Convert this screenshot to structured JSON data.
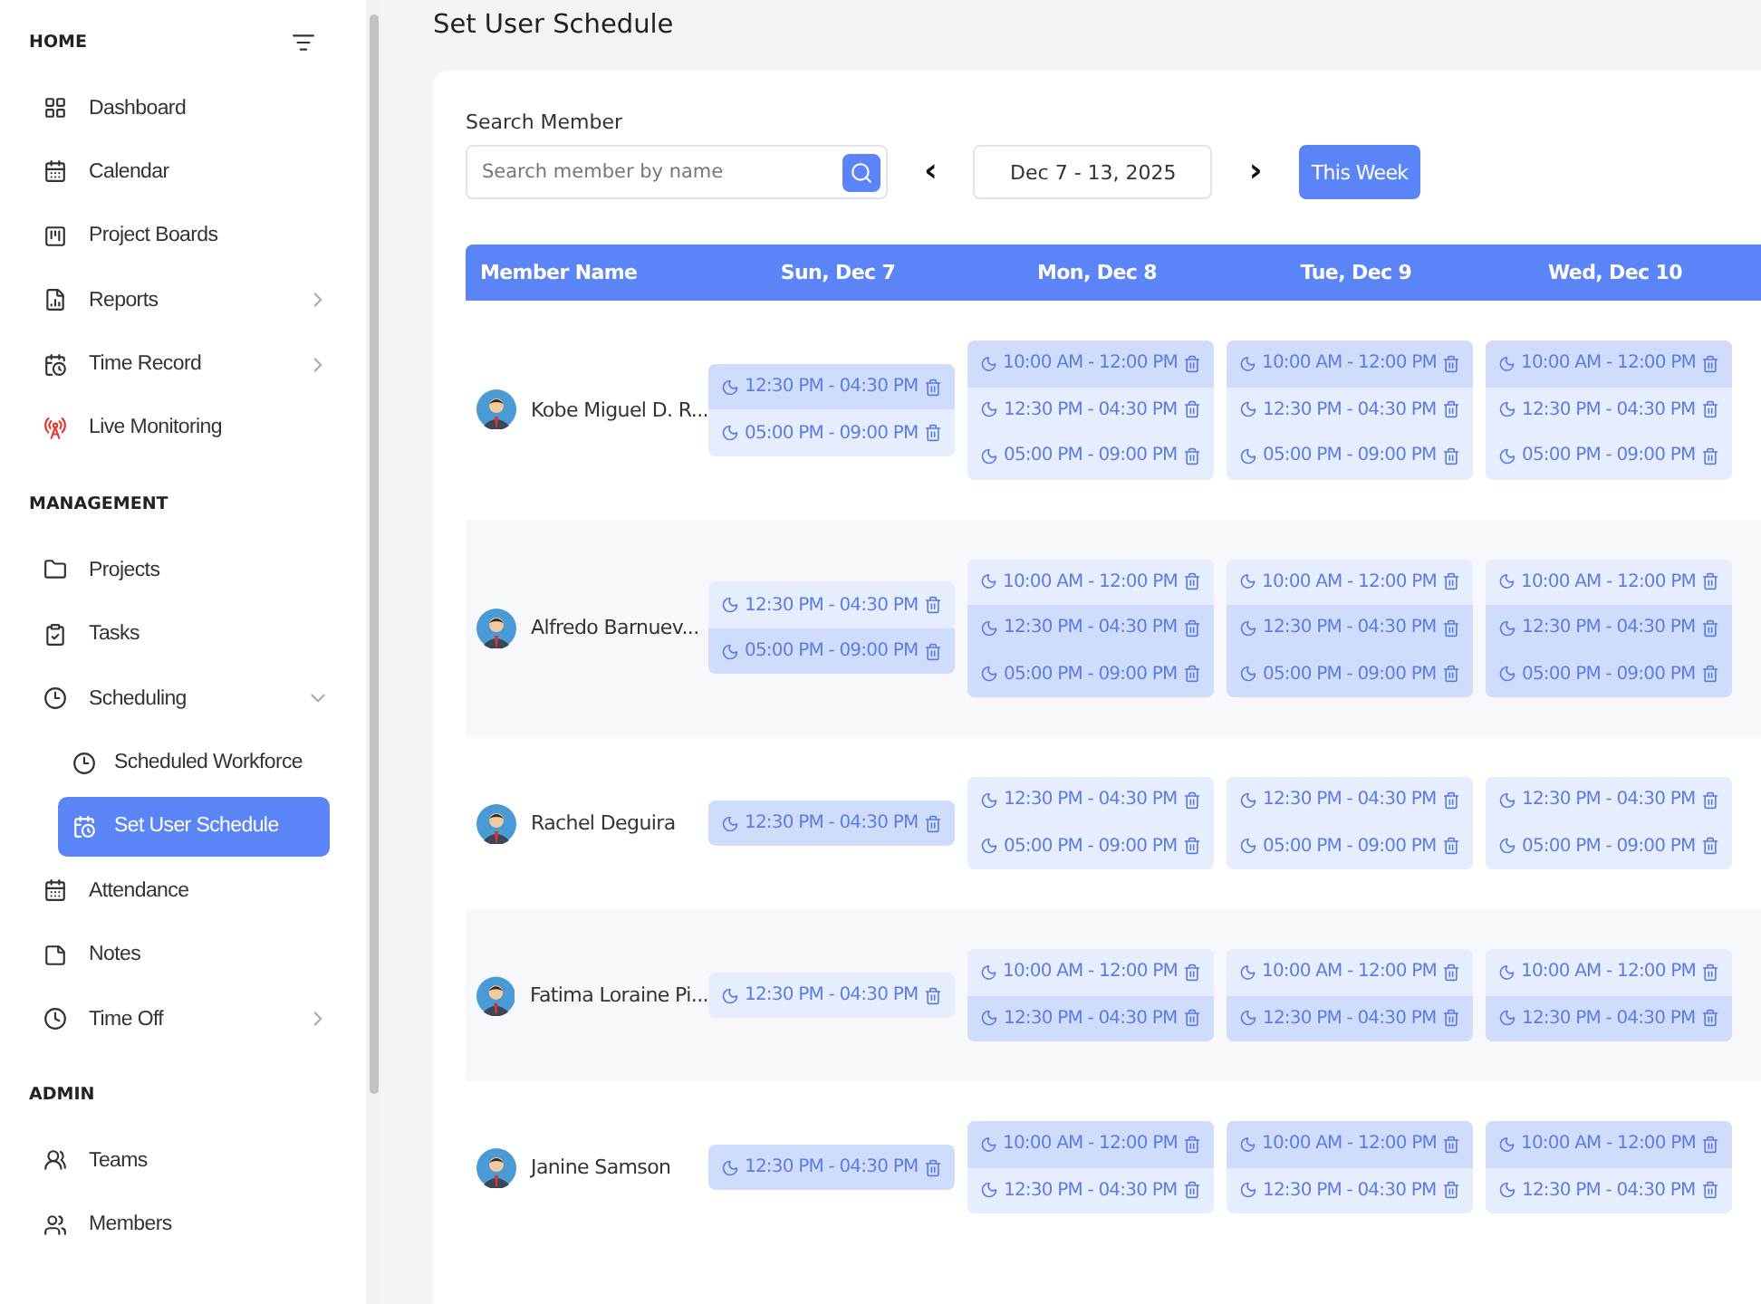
{
  "sidebar": {
    "sections": [
      {
        "heading": "HOME",
        "items": [
          {
            "label": "Dashboard",
            "kind": "link",
            "selected": false
          },
          {
            "label": "Calendar",
            "kind": "link",
            "selected": false
          },
          {
            "label": "Project Boards",
            "kind": "link",
            "selected": false
          },
          {
            "label": "Reports",
            "kind": "group",
            "expanded": false,
            "selected": false
          },
          {
            "label": "Time Record",
            "kind": "group",
            "expanded": false,
            "selected": false
          },
          {
            "label": "Live Monitoring",
            "kind": "link",
            "selected": false
          }
        ]
      },
      {
        "heading": "MANAGEMENT",
        "items": [
          {
            "label": "Projects",
            "kind": "link",
            "selected": false
          },
          {
            "label": "Tasks",
            "kind": "link",
            "selected": false
          },
          {
            "label": "Scheduling",
            "kind": "group",
            "expanded": true,
            "selected": false,
            "children": [
              {
                "label": "Scheduled Workforce",
                "selected": false
              },
              {
                "label": "Set User Schedule",
                "selected": true
              }
            ]
          },
          {
            "label": "Attendance",
            "kind": "link",
            "selected": false
          },
          {
            "label": "Notes",
            "kind": "link",
            "selected": false
          },
          {
            "label": "Time Off",
            "kind": "group",
            "expanded": false,
            "selected": false
          }
        ]
      },
      {
        "heading": "ADMIN",
        "items": [
          {
            "label": "Teams",
            "kind": "link",
            "selected": false
          },
          {
            "label": "Members",
            "kind": "link",
            "selected": false
          }
        ]
      }
    ]
  },
  "page_title": "Set User Schedule",
  "search": {
    "label": "Search Member",
    "placeholder": "Search member by name"
  },
  "week": {
    "prev": "‹",
    "range": "Dec 7 - 13, 2025",
    "next": "›",
    "this_week": "This Week"
  },
  "table": {
    "columns": [
      "Member Name",
      "Sun, Dec 7",
      "Mon, Dec 8",
      "Tue, Dec 9",
      "Wed, Dec 10"
    ],
    "rows": [
      {
        "name": "Kobe Miguel D. R...",
        "days": [
          [
            {
              "time": "12:30 PM - 04:30 PM",
              "highlighted": true
            },
            {
              "time": "05:00 PM - 09:00 PM",
              "highlighted": false
            }
          ],
          [
            {
              "time": "10:00 AM - 12:00 PM",
              "highlighted": true
            },
            {
              "time": "12:30 PM - 04:30 PM",
              "highlighted": false
            },
            {
              "time": "05:00 PM - 09:00 PM",
              "highlighted": false
            }
          ],
          [
            {
              "time": "10:00 AM - 12:00 PM",
              "highlighted": true
            },
            {
              "time": "12:30 PM - 04:30 PM",
              "highlighted": false
            },
            {
              "time": "05:00 PM - 09:00 PM",
              "highlighted": false
            }
          ],
          [
            {
              "time": "10:00 AM - 12:00 PM",
              "highlighted": true
            },
            {
              "time": "12:30 PM - 04:30 PM",
              "highlighted": false
            },
            {
              "time": "05:00 PM - 09:00 PM",
              "highlighted": false
            }
          ]
        ]
      },
      {
        "name": "Alfredo Barnuev...",
        "days": [
          [
            {
              "time": "12:30 PM - 04:30 PM",
              "highlighted": false
            },
            {
              "time": "05:00 PM - 09:00 PM",
              "highlighted": true
            }
          ],
          [
            {
              "time": "10:00 AM - 12:00 PM",
              "highlighted": false
            },
            {
              "time": "12:30 PM - 04:30 PM",
              "highlighted": true
            },
            {
              "time": "05:00 PM - 09:00 PM",
              "highlighted": true
            }
          ],
          [
            {
              "time": "10:00 AM - 12:00 PM",
              "highlighted": false
            },
            {
              "time": "12:30 PM - 04:30 PM",
              "highlighted": true
            },
            {
              "time": "05:00 PM - 09:00 PM",
              "highlighted": true
            }
          ],
          [
            {
              "time": "10:00 AM - 12:00 PM",
              "highlighted": false
            },
            {
              "time": "12:30 PM - 04:30 PM",
              "highlighted": true
            },
            {
              "time": "05:00 PM - 09:00 PM",
              "highlighted": true
            }
          ]
        ]
      },
      {
        "name": "Rachel Deguira",
        "days": [
          [
            {
              "time": "12:30 PM - 04:30 PM",
              "highlighted": true
            }
          ],
          [
            {
              "time": "12:30 PM - 04:30 PM",
              "highlighted": false
            },
            {
              "time": "05:00 PM - 09:00 PM",
              "highlighted": false
            }
          ],
          [
            {
              "time": "12:30 PM - 04:30 PM",
              "highlighted": false
            },
            {
              "time": "05:00 PM - 09:00 PM",
              "highlighted": false
            }
          ],
          [
            {
              "time": "12:30 PM - 04:30 PM",
              "highlighted": false
            },
            {
              "time": "05:00 PM - 09:00 PM",
              "highlighted": false
            }
          ]
        ]
      },
      {
        "name": "Fatima Loraine Pi...",
        "days": [
          [
            {
              "time": "12:30 PM - 04:30 PM",
              "highlighted": false
            }
          ],
          [
            {
              "time": "10:00 AM - 12:00 PM",
              "highlighted": false
            },
            {
              "time": "12:30 PM - 04:30 PM",
              "highlighted": true
            }
          ],
          [
            {
              "time": "10:00 AM - 12:00 PM",
              "highlighted": false
            },
            {
              "time": "12:30 PM - 04:30 PM",
              "highlighted": true
            }
          ],
          [
            {
              "time": "10:00 AM - 12:00 PM",
              "highlighted": false
            },
            {
              "time": "12:30 PM - 04:30 PM",
              "highlighted": true
            }
          ]
        ]
      },
      {
        "name": "Janine Samson",
        "days": [
          [
            {
              "time": "12:30 PM - 04:30 PM",
              "highlighted": true
            }
          ],
          [
            {
              "time": "10:00 AM - 12:00 PM",
              "highlighted": true
            },
            {
              "time": "12:30 PM - 04:30 PM",
              "highlighted": false
            }
          ],
          [
            {
              "time": "10:00 AM - 12:00 PM",
              "highlighted": true
            },
            {
              "time": "12:30 PM - 04:30 PM",
              "highlighted": false
            }
          ],
          [
            {
              "time": "10:00 AM - 12:00 PM",
              "highlighted": true
            },
            {
              "time": "12:30 PM - 04:30 PM",
              "highlighted": false
            }
          ]
        ]
      }
    ]
  }
}
